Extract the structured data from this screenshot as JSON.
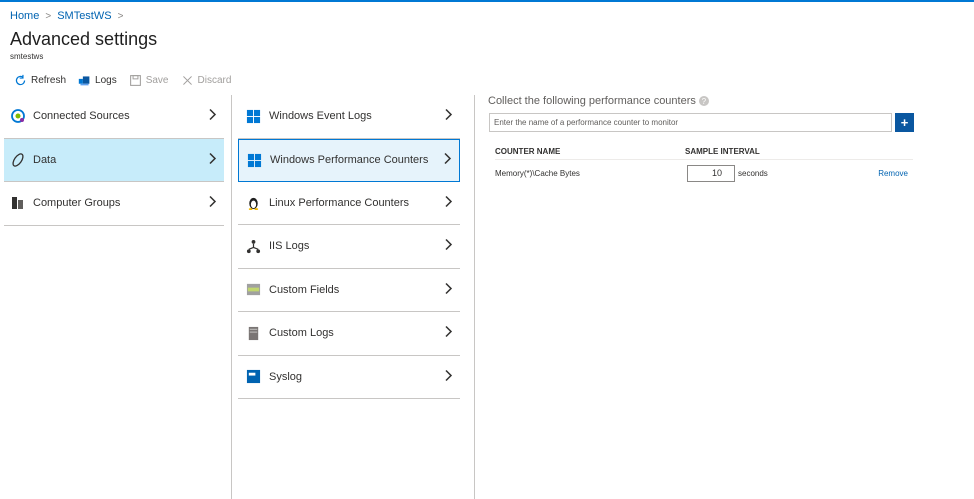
{
  "breadcrumb": {
    "home": "Home",
    "workspace": "SMTestWS"
  },
  "header": {
    "title": "Advanced settings",
    "subtitle": "smtestws"
  },
  "toolbar": {
    "refresh": "Refresh",
    "logs": "Logs",
    "save": "Save",
    "discard": "Discard"
  },
  "nav1": [
    {
      "label": "Connected Sources",
      "icon": "connected-sources-icon"
    },
    {
      "label": "Data",
      "icon": "data-icon",
      "active": true
    },
    {
      "label": "Computer Groups",
      "icon": "computer-groups-icon"
    }
  ],
  "nav2": [
    {
      "label": "Windows Event Logs",
      "icon": "windows-icon"
    },
    {
      "label": "Windows Performance Counters",
      "icon": "windows-icon",
      "active": true
    },
    {
      "label": "Linux Performance Counters",
      "icon": "linux-icon"
    },
    {
      "label": "IIS Logs",
      "icon": "iis-logs-icon"
    },
    {
      "label": "Custom Fields",
      "icon": "custom-fields-icon"
    },
    {
      "label": "Custom Logs",
      "icon": "custom-logs-icon"
    },
    {
      "label": "Syslog",
      "icon": "syslog-icon"
    }
  ],
  "panel": {
    "title": "Collect the following performance counters",
    "search_placeholder": "Enter the name of a performance counter to monitor",
    "add_label": "+",
    "col_counter": "COUNTER NAME",
    "col_interval": "SAMPLE INTERVAL",
    "rows": [
      {
        "counter": "Memory(*)\\Cache Bytes",
        "interval": "10",
        "unit": "seconds",
        "action": "Remove"
      }
    ]
  },
  "colors": {
    "accent": "#0078d4",
    "active_bg": "#c7ecfa",
    "button": "#0a57a0"
  }
}
